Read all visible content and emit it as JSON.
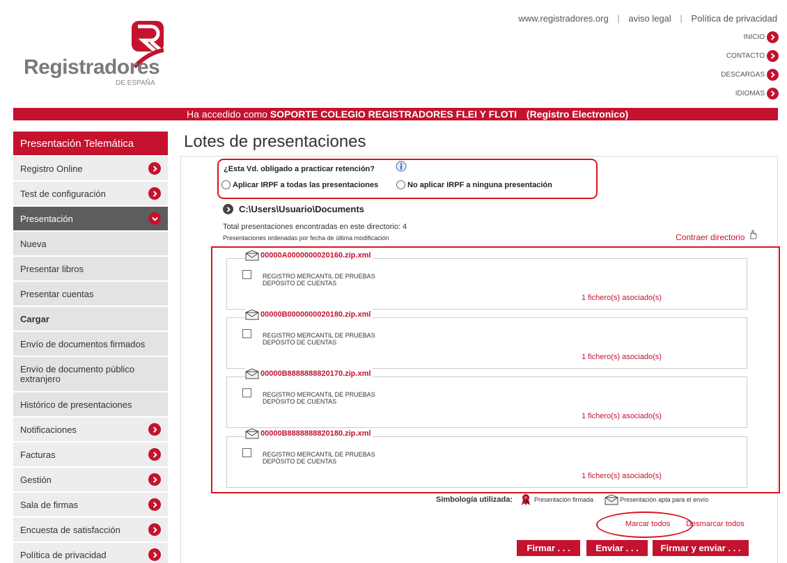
{
  "brand": {
    "name": "Registradores",
    "sub": "DE ESPAÑA"
  },
  "top_links": [
    "www.registradores.org",
    "aviso legal",
    "Política de privacidad"
  ],
  "right_nav": [
    "INICIO",
    "CONTACTO",
    "DESCARGAS",
    "IDIOMAS"
  ],
  "banner": {
    "prefix": "Ha accedido como",
    "user": "SOPORTE COLEGIO REGISTRADORES FLEI Y FLOTI",
    "suffix": "(Registro Electronico)"
  },
  "sidebar": {
    "title": "Presentación Telemática",
    "items": [
      {
        "label": "Registro Online"
      },
      {
        "label": "Test de configuración"
      },
      {
        "label": "Presentación"
      },
      {
        "label": "Nueva"
      },
      {
        "label": "Presentar libros"
      },
      {
        "label": "Presentar cuentas"
      },
      {
        "label": "Cargar"
      },
      {
        "label": "Envío de documentos firmados"
      },
      {
        "label": "Envío de documento público extranjero"
      },
      {
        "label": "Histórico de presentaciones"
      },
      {
        "label": "Notificaciones"
      },
      {
        "label": "Facturas"
      },
      {
        "label": "Gestión"
      },
      {
        "label": "Sala de firmas"
      },
      {
        "label": "Encuesta de satisfacción"
      },
      {
        "label": "Política de privacidad"
      }
    ]
  },
  "main": {
    "title": "Lotes de presentaciones",
    "irpf": {
      "question": "¿Esta Vd. obligado a practicar retención?",
      "option_all": "Aplicar IRPF a todas las presentaciones",
      "option_none": "No aplicar IRPF a ninguna presentación"
    },
    "directory": "C:\\Users\\Usuario\\Documents",
    "total": "Total presentaciones encontradas en este directorio: 4",
    "sorted": "Presentaciones ordenadas por fecha de última modificación",
    "collapse": "Contraer directorio",
    "lots": [
      {
        "file": "00000A0000000020160.zip.xml",
        "registry": "REGISTRO MERCANTIL DE PRUEBAS",
        "type": "DEPÓSITO DE CUENTAS",
        "assoc": "1 fichero(s) asociado(s)"
      },
      {
        "file": "00000B0000000020180.zip.xml",
        "registry": "REGISTRO MERCANTIL DE PRUEBAS",
        "type": "DEPÓSITO DE CUENTAS",
        "assoc": "1 fichero(s) asociado(s)"
      },
      {
        "file": "00000B8888888820170.zip.xml",
        "registry": "REGISTRO MERCANTIL DE PRUEBAS",
        "type": "DEPÓSITO DE CUENTAS",
        "assoc": "1 fichero(s) asociado(s)"
      },
      {
        "file": "00000B8888888820180.zip.xml",
        "registry": "REGISTRO MERCANTIL DE PRUEBAS",
        "type": "DEPÓSITO DE CUENTAS",
        "assoc": "1 fichero(s) asociado(s)"
      }
    ],
    "legend": {
      "label": "Simbología utilizada:",
      "signed": "Presentación firmada",
      "ready": "Presentación apta para el envío"
    },
    "select_all": "Marcar todos",
    "deselect_all": "Desmarcar todos",
    "buttons": {
      "sign": "Firmar . . .",
      "send": "Enviar . . .",
      "sign_send": "Firmar y enviar . . ."
    }
  },
  "colors": {
    "brand_red": "#c4122f",
    "annotation_red": "#d8151f",
    "sidebar_active": "#5d5d5d"
  },
  "icons": [
    "chevron-right-icon",
    "chevron-down-icon",
    "info-icon",
    "hand-cursor-icon",
    "envelope-icon",
    "ribbon-icon"
  ]
}
